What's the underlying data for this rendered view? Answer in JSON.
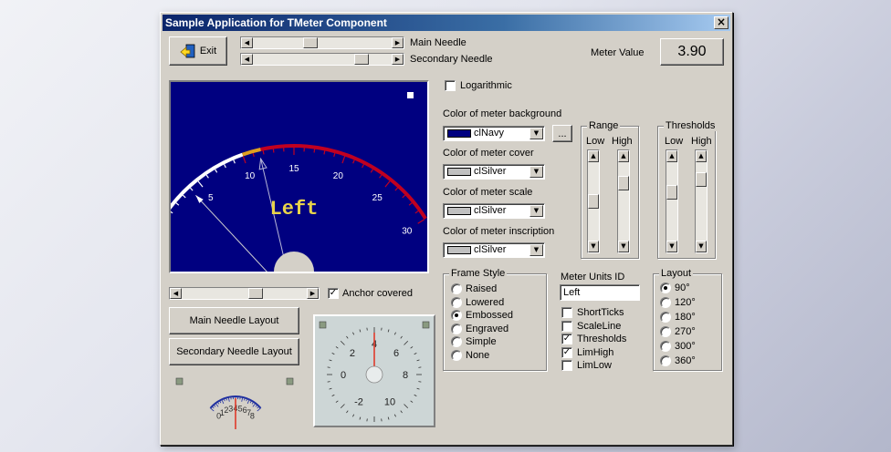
{
  "window": {
    "title": "Sample Application for TMeter Component"
  },
  "toolbar": {
    "exit_label": "Exit",
    "main_needle_label": "Main Needle",
    "secondary_needle_label": "Secondary Needle",
    "meter_value_label": "Meter Value",
    "meter_value": "3.90"
  },
  "main_meter": {
    "caption": "Left",
    "scale_labels": [
      "5",
      "10",
      "15",
      "20",
      "25",
      "30"
    ],
    "main_needle_value": 3.9,
    "secondary_needle_value": 11.6,
    "scale_min": 0,
    "scale_max": 30,
    "threshold_low": 10,
    "threshold_high": 30,
    "colors": {
      "background": "#000080",
      "scale": "#ffffff",
      "threshold_low": "#e0a020",
      "threshold_high": "#c00020",
      "inscription": "#e8d44a"
    }
  },
  "left_controls": {
    "anchor_covered_label": "Anchor covered",
    "anchor_covered_checked": true,
    "main_needle_layout_label": "Main Needle Layout",
    "secondary_needle_layout_label": "Secondary Needle Layout"
  },
  "small_meter": {
    "labels": [
      "0",
      "1",
      "2",
      "3",
      "4",
      "5",
      "6",
      "7",
      "8"
    ]
  },
  "round_meter": {
    "labels": [
      "-2",
      "0",
      "2",
      "4",
      "6",
      "8",
      "10"
    ]
  },
  "options": {
    "logarithmic_label": "Logarithmic",
    "logarithmic_checked": false,
    "background_label": "Color of meter background",
    "background_value": "clNavy",
    "background_swatch": "#000080",
    "ellipsis_label": "...",
    "cover_label": "Color of meter cover",
    "cover_value": "clSilver",
    "scale_label": "Color of meter scale",
    "scale_value": "clSilver",
    "inscription_label": "Color of meter inscription",
    "inscription_value": "clSilver",
    "silver_swatch": "#c0c0c0"
  },
  "range": {
    "title": "Range",
    "low_label": "Low",
    "high_label": "High"
  },
  "thresholds": {
    "title": "Thresholds",
    "low_label": "Low",
    "high_label": "High"
  },
  "frame_style": {
    "title": "Frame Style",
    "options": [
      "Raised",
      "Lowered",
      "Embossed",
      "Engraved",
      "Simple",
      "None"
    ],
    "selected": "Embossed"
  },
  "units": {
    "label": "Meter Units ID",
    "value": "Left",
    "checks": [
      {
        "label": "ShortTicks",
        "checked": false
      },
      {
        "label": "ScaleLine",
        "checked": false
      },
      {
        "label": "Thresholds",
        "checked": true
      },
      {
        "label": "LimHigh",
        "checked": true
      },
      {
        "label": "LimLow",
        "checked": false
      }
    ]
  },
  "layout": {
    "title": "Layout",
    "options": [
      "90°",
      "120°",
      "180°",
      "270°",
      "300°",
      "360°"
    ],
    "selected": "90°"
  }
}
